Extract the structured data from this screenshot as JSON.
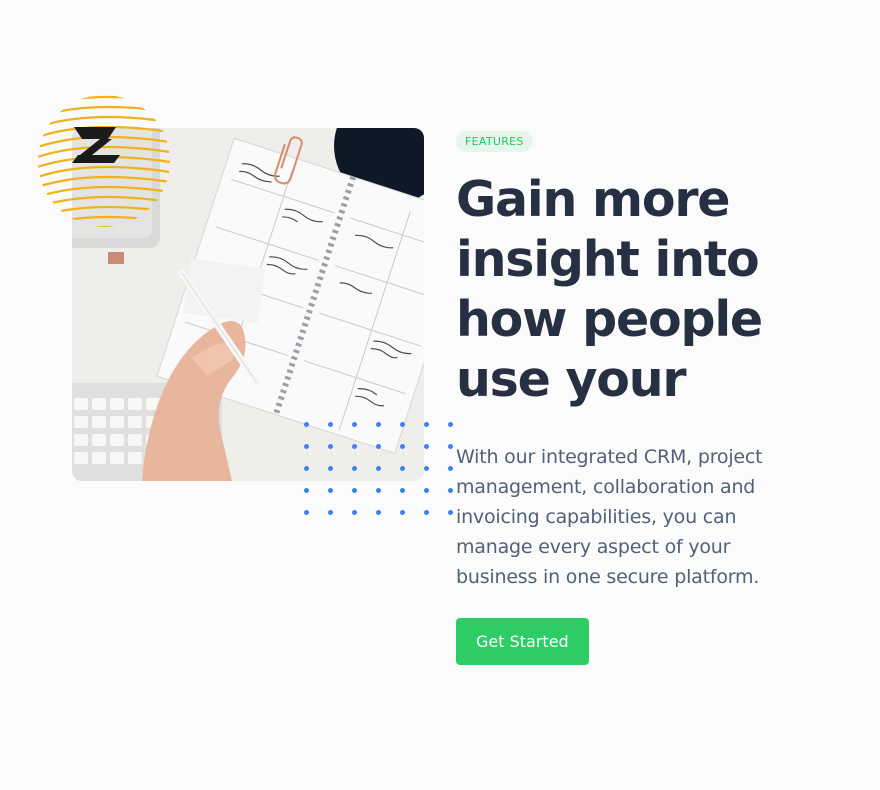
{
  "section": {
    "badge": "FEATURES",
    "headline": "Gain more insight into how people use your",
    "body": "With our integrated CRM, project management, collaboration and invoicing capabilities, you can manage every aspect of your business in one secure platform.",
    "cta_label": "Get Started"
  },
  "colors": {
    "accent_green": "#2ecc64",
    "badge_bg": "#e7f6ec",
    "heading": "#273043",
    "body_text": "#536079",
    "dot_blue": "#3b82f6",
    "ring_yellow": "#f4b400"
  },
  "image": {
    "icon": "notebook-planner-photo"
  }
}
